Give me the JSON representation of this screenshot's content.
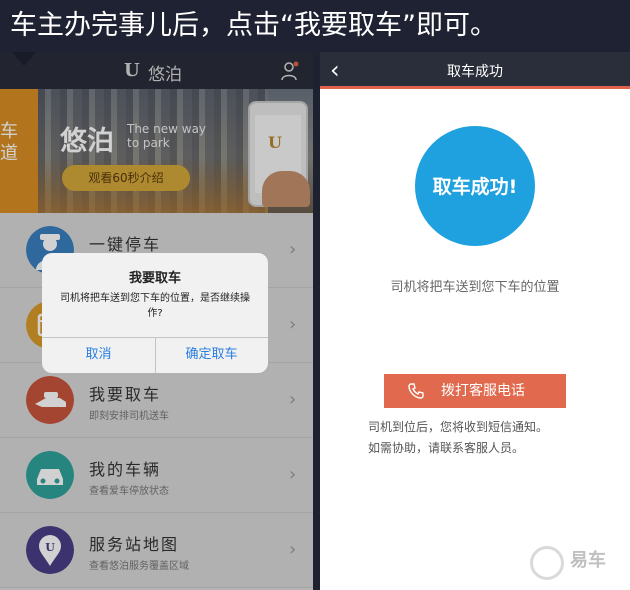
{
  "caption": "车主办完事儿后，点击“我要取车”即可。",
  "left": {
    "header": {
      "logo": "U",
      "title": "悠泊"
    },
    "banner": {
      "side_text": "车\n道",
      "brand": "悠泊",
      "slogan_line1": "The new way",
      "slogan_line2": "to park",
      "video_button": "观看60秒介绍",
      "phone_logo": "U",
      "page_index": 2,
      "page_count": 3
    },
    "menu": [
      {
        "title": "一键停车",
        "subtitle": "",
        "icon": "valet-driver-icon",
        "color": "#3a7fbf"
      },
      {
        "title": "",
        "subtitle": "",
        "icon": "calendar-icon",
        "color": "#d99a2a"
      },
      {
        "title": "我要取车",
        "subtitle": "即刻安排司机送车",
        "icon": "hand-car-icon",
        "color": "#c9553d"
      },
      {
        "title": "我的车辆",
        "subtitle": "查看爱车停放状态",
        "icon": "car-icon",
        "color": "#2fa39c"
      },
      {
        "title": "服务站地图",
        "subtitle": "查看悠泊服务覆盖区域",
        "icon": "map-pin-icon",
        "color": "#4a3d85"
      }
    ],
    "dialog": {
      "title": "我要取车",
      "message": "司机将把车送到您下车的位置，是否继续操作?",
      "cancel": "取消",
      "confirm": "确定取车"
    }
  },
  "right": {
    "header": {
      "back": "‹",
      "title": "取车成功"
    },
    "success_text": "取车成功!",
    "description": "司机将把车送到您下车的位置",
    "call_button": "拨打客服电话",
    "note_line1": "司机到位后，您将收到短信通知。",
    "note_line2": "如需协助，请联系客服人员。"
  },
  "watermark": {
    "text": "易车"
  },
  "colors": {
    "header_bg": "#2a2d3a",
    "accent_orange": "#e1694e",
    "success_blue": "#1fa1e0",
    "link_blue": "#2a7ee0"
  }
}
